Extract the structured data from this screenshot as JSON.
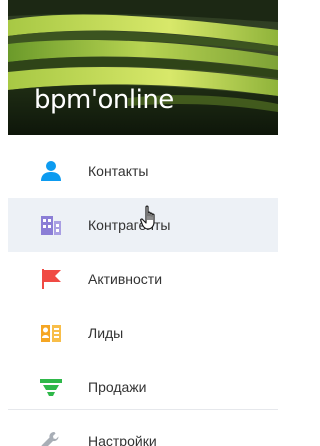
{
  "logo": {
    "text": "bpm'online"
  },
  "menu": {
    "items": [
      {
        "label": "Контакты",
        "icon": "contact-person-icon",
        "color": "#0d9bf0"
      },
      {
        "label": "Контрагенты",
        "icon": "building-icon",
        "color": "#8b7ed6",
        "active": true
      },
      {
        "label": "Активности",
        "icon": "flag-icon",
        "color": "#f04a44"
      },
      {
        "label": "Лиды",
        "icon": "lead-icon",
        "color": "#f5a623"
      },
      {
        "label": "Продажи",
        "icon": "funnel-icon",
        "color": "#2fb84a"
      },
      {
        "label": "Настройки",
        "icon": "wrench-icon",
        "color": "#a8aeb6"
      }
    ]
  },
  "colors": {
    "active_bg": "#edf1f6",
    "text": "#333333"
  }
}
